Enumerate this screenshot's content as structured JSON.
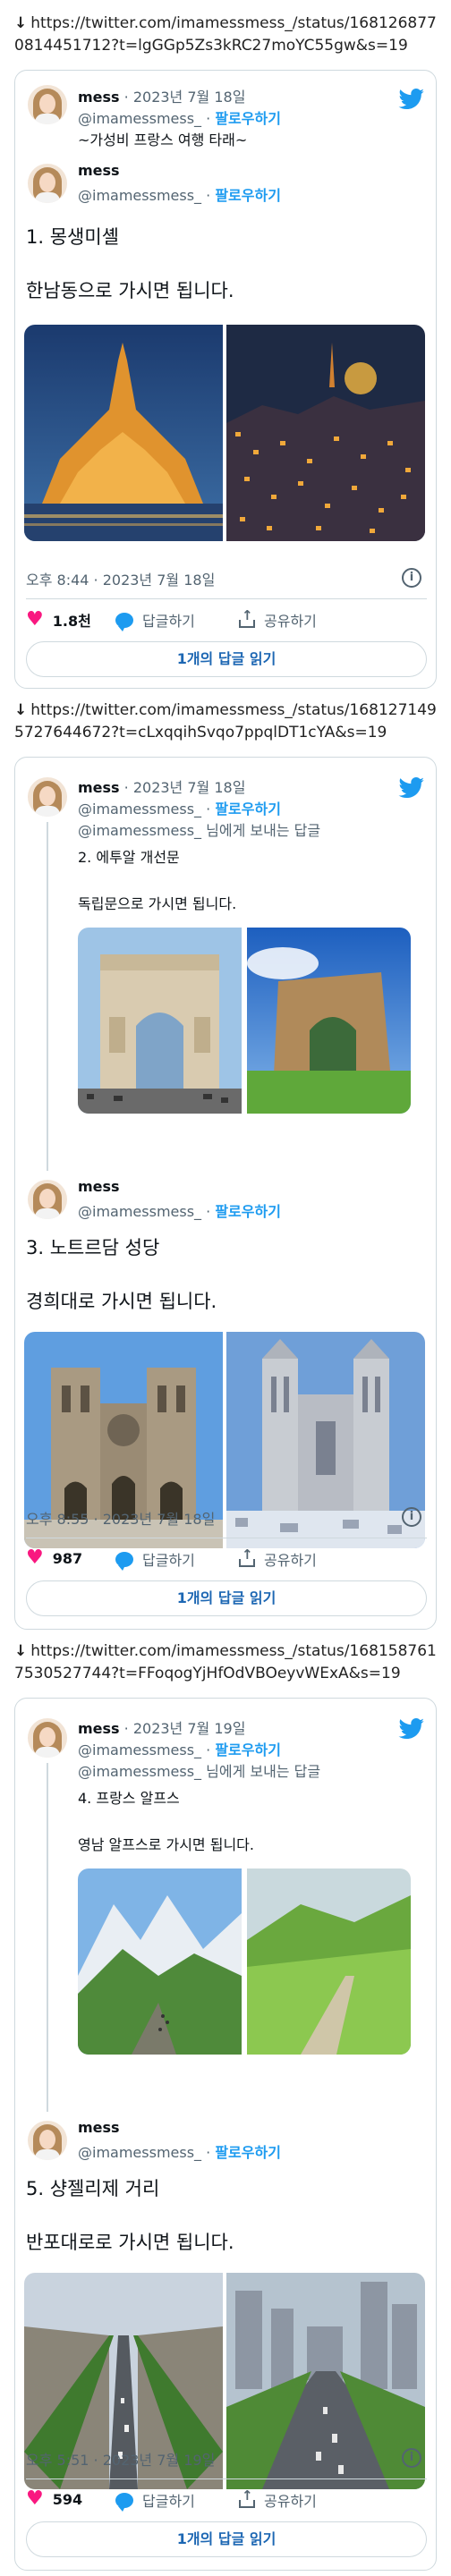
{
  "posts": [
    {
      "url": "https://twitter.com/imamessmess_/status/1681268770814451712?t=lgGGp5Zs3kRC27moYC55gw&s=19",
      "first": {
        "name": "mess",
        "date": " · 2023년 7월 18일",
        "handle": "@imamessmess_",
        "follow": "팔로우하기",
        "text": "~가성비 프랑스 여행 타래~"
      },
      "second": {
        "name": "mess",
        "handle": "@imamessmess_",
        "follow": "팔로우하기",
        "line1": "1. 몽생미셸",
        "line2": "한남동으로 가시면 됩니다."
      },
      "time": "오후 8:44 · 2023년 7월 18일",
      "likes": "1.8천",
      "reply": "답글하기",
      "share": "공유하기",
      "read": "1개의 답글 읽기",
      "left_image": "mont-saint-michel-night",
      "right_image": "hannam-dong-night"
    },
    {
      "url": "https://twitter.com/imamessmess_/status/1681271495727644672?t=cLxqqihSvqo7ppqlDT1cYA&s=19",
      "first": {
        "name": "mess",
        "date": " · 2023년 7월 18일",
        "handle": "@imamessmess_",
        "follow": "팔로우하기",
        "reply_to": "@imamessmess_ 님에게 보내는 답글",
        "line1": "2. 에투알 개선문",
        "line2": "독립문으로 가시면 됩니다."
      },
      "second": {
        "name": "mess",
        "handle": "@imamessmess_",
        "follow": "팔로우하기",
        "line1": "3. 노트르담 성당",
        "line2": "경희대로 가시면 됩니다."
      },
      "time": "오후 8:55 · 2023년 7월 18일",
      "likes": "987",
      "reply": "답글하기",
      "share": "공유하기",
      "read": "1개의 답글 읽기",
      "small_left_image": "arc-de-triomphe",
      "small_right_image": "dongnimmun",
      "left_image": "notre-dame",
      "right_image": "kyung-hee-university"
    },
    {
      "url": "https://twitter.com/imamessmess_/status/1681587617530527744?t=FFoqogYjHfOdVBOeyvWExA&s=19",
      "first": {
        "name": "mess",
        "date": " · 2023년 7월 19일",
        "handle": "@imamessmess_",
        "follow": "팔로우하기",
        "reply_to": "@imamessmess_ 님에게 보내는 답글",
        "line1": "4. 프랑스 알프스",
        "line2": "영남 알프스로 가시면 됩니다."
      },
      "second": {
        "name": "mess",
        "handle": "@imamessmess_",
        "follow": "팔로우하기",
        "line1": "5. 샹젤리제 거리",
        "line2": "반포대로로 가시면 됩니다."
      },
      "time": "오후 5:51 · 2023년 7월 19일",
      "likes": "594",
      "reply": "답글하기",
      "share": "공유하기",
      "read": "1개의 답글 읽기",
      "small_left_image": "french-alps",
      "small_right_image": "yeongnam-alps",
      "left_image": "champs-elysees",
      "right_image": "banpo-daero"
    }
  ],
  "colors": {
    "accent": "#1d9bf0",
    "like": "#f91880",
    "border": "#cfd9de",
    "muted": "#536471"
  },
  "icons": {
    "download": "down-arrow-icon",
    "logo": "twitter-bird-icon",
    "info": "info-icon"
  },
  "arrow": "↓",
  "info": "i"
}
